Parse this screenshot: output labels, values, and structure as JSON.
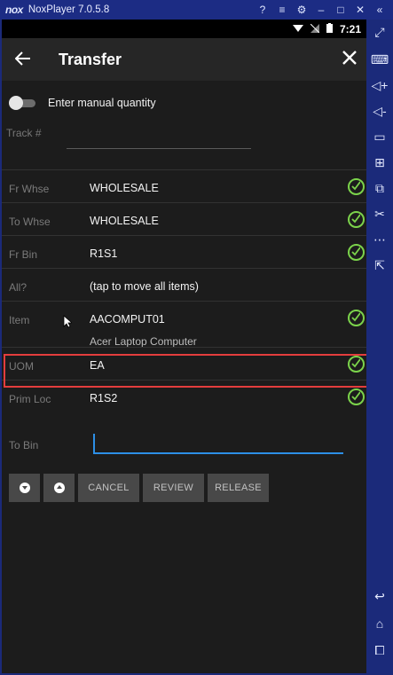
{
  "emulator": {
    "logo": "nox",
    "title": "NoxPlayer 7.0.5.8",
    "title_controls": [
      "?",
      "≡",
      "⚙",
      "–",
      "□",
      "✕",
      "«"
    ]
  },
  "status_bar": {
    "time": "7:21"
  },
  "app_bar": {
    "title": "Transfer"
  },
  "manual_quantity": {
    "label": "Enter manual quantity",
    "enabled": false
  },
  "track": {
    "label": "Track #",
    "value": ""
  },
  "fields": [
    {
      "label": "Fr Whse",
      "value": "WHOLESALE",
      "verified": true
    },
    {
      "label": "To Whse",
      "value": "WHOLESALE",
      "verified": true
    },
    {
      "label": "Fr Bin",
      "value": "R1S1",
      "verified": true
    },
    {
      "label": "All?",
      "value": "(tap to move all items)",
      "verified": false
    },
    {
      "label": "Item",
      "value": "AACOMPUT01",
      "description": "Acer Laptop Computer",
      "verified": true
    },
    {
      "label": "UOM",
      "value": "EA",
      "verified": true
    },
    {
      "label": "Prim Loc",
      "value": "R1S2",
      "verified": true
    }
  ],
  "to_bin": {
    "label": "To Bin",
    "value": ""
  },
  "buttons": {
    "cancel": "CANCEL",
    "review": "REVIEW",
    "release": "RELEASE"
  },
  "colors": {
    "check": "#7bd34b",
    "highlight": "#e33d3d",
    "input_focus": "#2d8fe6"
  }
}
